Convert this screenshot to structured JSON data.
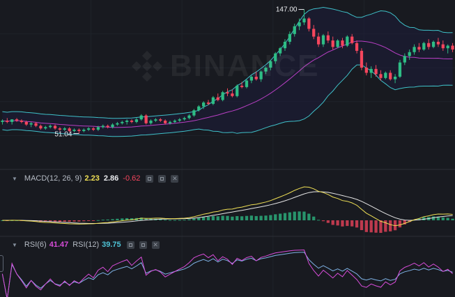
{
  "watermark": {
    "text": "BINANCE"
  },
  "price_panel": {
    "high_label": "147.00",
    "low_label": "51.04"
  },
  "macd": {
    "name": "MACD(12, 26, 9)",
    "macd_value": "2.23",
    "signal_value": "2.86",
    "hist_value": "-0.62"
  },
  "rsi": {
    "rsi6_name": "RSI(6)",
    "rsi6_value": "41.47",
    "rsi12_name": "RSI(12)",
    "rsi12_value": "39.75"
  },
  "colors": {
    "background": "#181a20",
    "up": "#2ebd85",
    "down": "#f6465d",
    "boll_band": "#3fc1c9",
    "boll_mid": "#b83fc4",
    "macd_line": "#f0e055",
    "signal_line": "#e6e6e6",
    "rsi6": "#d74cd8",
    "rsi12": "#7fb3e6"
  },
  "chart_data": {
    "type": "candlestick",
    "series": {
      "ohlc": [
        [
          60,
          62,
          58,
          61
        ],
        [
          61,
          63,
          59,
          60
        ],
        [
          60,
          62,
          58,
          62
        ],
        [
          62,
          63,
          60,
          61
        ],
        [
          61,
          62,
          59,
          60
        ],
        [
          60,
          61,
          57,
          58
        ],
        [
          58,
          60,
          56,
          59
        ],
        [
          59,
          60,
          56,
          57
        ],
        [
          57,
          58,
          54,
          55
        ],
        [
          55,
          57,
          54,
          56
        ],
        [
          56,
          58,
          55,
          57
        ],
        [
          57,
          58,
          54,
          55
        ],
        [
          55,
          56,
          53,
          54
        ],
        [
          54,
          56,
          53,
          55
        ],
        [
          55,
          56,
          52,
          53
        ],
        [
          53,
          55,
          52,
          54
        ],
        [
          54,
          55,
          51.04,
          53
        ],
        [
          53,
          55,
          52,
          54
        ],
        [
          54,
          56,
          53,
          55
        ],
        [
          55,
          56,
          53,
          54
        ],
        [
          54,
          57,
          53,
          56
        ],
        [
          56,
          58,
          55,
          57
        ],
        [
          57,
          58,
          55,
          56
        ],
        [
          56,
          59,
          55,
          58
        ],
        [
          58,
          60,
          57,
          59
        ],
        [
          59,
          61,
          58,
          60
        ],
        [
          60,
          62,
          58,
          61
        ],
        [
          61,
          62,
          59,
          60
        ],
        [
          60,
          63,
          59,
          62
        ],
        [
          62,
          66,
          61,
          65
        ],
        [
          65,
          66,
          58,
          59
        ],
        [
          59,
          62,
          58,
          61
        ],
        [
          61,
          63,
          60,
          62
        ],
        [
          62,
          63,
          60,
          61
        ],
        [
          61,
          62,
          58,
          59
        ],
        [
          59,
          61,
          58,
          60
        ],
        [
          60,
          62,
          59,
          61
        ],
        [
          61,
          63,
          60,
          62
        ],
        [
          62,
          64,
          61,
          63
        ],
        [
          63,
          66,
          62,
          65
        ],
        [
          65,
          70,
          64,
          69
        ],
        [
          69,
          73,
          68,
          72
        ],
        [
          72,
          76,
          70,
          75
        ],
        [
          75,
          77,
          73,
          74
        ],
        [
          74,
          80,
          73,
          79
        ],
        [
          79,
          82,
          76,
          77
        ],
        [
          77,
          84,
          76,
          83
        ],
        [
          83,
          86,
          80,
          82
        ],
        [
          82,
          85,
          79,
          80
        ],
        [
          80,
          89,
          79,
          88
        ],
        [
          88,
          91,
          86,
          87
        ],
        [
          87,
          93,
          86,
          92
        ],
        [
          92,
          96,
          90,
          95
        ],
        [
          95,
          99,
          92,
          93
        ],
        [
          93,
          100,
          91,
          99
        ],
        [
          99,
          103,
          97,
          102
        ],
        [
          102,
          108,
          100,
          107
        ],
        [
          107,
          114,
          105,
          113
        ],
        [
          113,
          118,
          111,
          117
        ],
        [
          117,
          124,
          115,
          122
        ],
        [
          122,
          130,
          120,
          128
        ],
        [
          128,
          136,
          126,
          134
        ],
        [
          134,
          140,
          131,
          137
        ],
        [
          137,
          147.0,
          135,
          140
        ],
        [
          140,
          141,
          130,
          132
        ],
        [
          132,
          135,
          124,
          126
        ],
        [
          126,
          129,
          118,
          120
        ],
        [
          120,
          128,
          118,
          127
        ],
        [
          127,
          130,
          121,
          123
        ],
        [
          123,
          126,
          116,
          118
        ],
        [
          118,
          124,
          117,
          123
        ],
        [
          123,
          125,
          117,
          119
        ],
        [
          119,
          127,
          118,
          126
        ],
        [
          126,
          128,
          120,
          121
        ],
        [
          121,
          123,
          113,
          115
        ],
        [
          115,
          117,
          100,
          102
        ],
        [
          102,
          106,
          96,
          98
        ],
        [
          98,
          103,
          94,
          101
        ],
        [
          101,
          104,
          95,
          97
        ],
        [
          97,
          100,
          92,
          94
        ],
        [
          94,
          99,
          93,
          98
        ],
        [
          98,
          100,
          92,
          93
        ],
        [
          93,
          97,
          90,
          95
        ],
        [
          95,
          108,
          94,
          106
        ],
        [
          106,
          113,
          104,
          111
        ],
        [
          111,
          116,
          108,
          114
        ],
        [
          114,
          120,
          112,
          118
        ],
        [
          118,
          121,
          114,
          116
        ],
        [
          116,
          122,
          115,
          121
        ],
        [
          121,
          124,
          116,
          118
        ],
        [
          118,
          123,
          117,
          122
        ],
        [
          122,
          125,
          118,
          120
        ],
        [
          120,
          123,
          115,
          117
        ],
        [
          117,
          120,
          113,
          119
        ],
        [
          119,
          121,
          114,
          116
        ]
      ]
    },
    "price_high": 147.0,
    "price_low": 51.04,
    "macd": {
      "macd": 2.23,
      "signal": 2.86,
      "hist": -0.62
    },
    "rsi": {
      "rsi6": 41.47,
      "rsi12": 39.75
    }
  }
}
